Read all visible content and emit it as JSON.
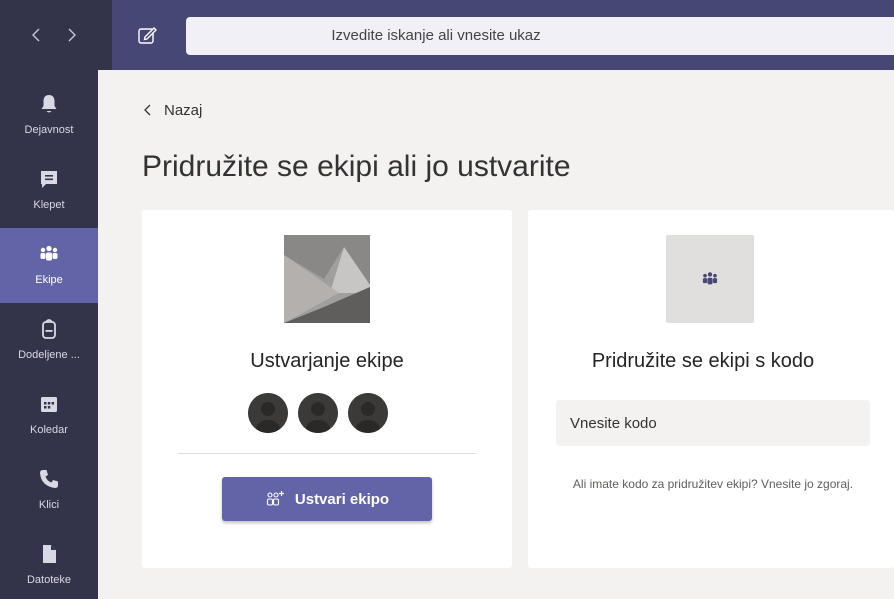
{
  "topbar": {
    "search_placeholder": "Izvedite iskanje ali vnesite ukaz",
    "back_arrow_icon": "chevron-left-icon",
    "forward_arrow_icon": "chevron-right-icon",
    "compose_icon": "compose-icon"
  },
  "rail": {
    "items": [
      {
        "label": "Dejavnost",
        "icon": "bell-icon",
        "active": false
      },
      {
        "label": "Klepet",
        "icon": "chat-icon",
        "active": false
      },
      {
        "label": "Ekipe",
        "icon": "teams-icon",
        "active": true
      },
      {
        "label": "Dodeljene ...",
        "icon": "backpack-icon",
        "active": false
      },
      {
        "label": "Koledar",
        "icon": "calendar-icon",
        "active": false
      },
      {
        "label": "Klici",
        "icon": "phone-icon",
        "active": false
      },
      {
        "label": "Datoteke",
        "icon": "file-icon",
        "active": false
      }
    ]
  },
  "main": {
    "back_label": "Nazaj",
    "title": "Pridružite se ekipi ali jo ustvarite",
    "create_card": {
      "title": "Ustvarjanje ekipe",
      "button_label": "Ustvari ekipo",
      "button_icon": "add-team-icon"
    },
    "join_card": {
      "title": "Pridružite se ekipi s kodo",
      "input_placeholder": "Vnesite kodo",
      "hint": "Ali imate kodo za pridružitev ekipi? Vnesite jo zgoraj."
    }
  },
  "colors": {
    "brand": "#6264a7",
    "topbar": "#464775",
    "rail": "#33344a"
  }
}
